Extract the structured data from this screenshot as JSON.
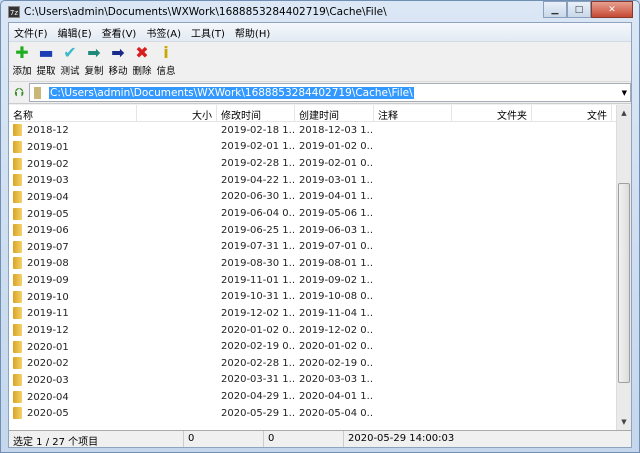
{
  "window": {
    "title": "C:\\Users\\admin\\Documents\\WXWork\\1688853284402719\\Cache\\File\\",
    "app_icon": "7z"
  },
  "menu": [
    "文件(F)",
    "编辑(E)",
    "查看(V)",
    "书签(A)",
    "工具(T)",
    "帮助(H)"
  ],
  "toolbar": [
    {
      "label": "添加",
      "icon": "plus-icon",
      "glyph": "✚",
      "color": "#1fae1f"
    },
    {
      "label": "提取",
      "icon": "minus-icon",
      "glyph": "▬",
      "color": "#1d3fb5"
    },
    {
      "label": "测试",
      "icon": "check-icon",
      "glyph": "✔",
      "color": "#3bb8c9"
    },
    {
      "label": "复制",
      "icon": "copy-arrow-icon",
      "glyph": "➡",
      "color": "#1f8a7a"
    },
    {
      "label": "移动",
      "icon": "move-arrow-icon",
      "glyph": "➡",
      "color": "#1a2a8a"
    },
    {
      "label": "删除",
      "icon": "delete-x-icon",
      "glyph": "✖",
      "color": "#d81e1e"
    },
    {
      "label": "信息",
      "icon": "info-icon",
      "glyph": "i",
      "color": "#c9a800"
    }
  ],
  "address": {
    "path": "C:\\Users\\admin\\Documents\\WXWork\\1688853284402719\\Cache\\File\\"
  },
  "columns": [
    "名称",
    "大小",
    "修改时间",
    "创建时间",
    "注释",
    "文件夹",
    "文件"
  ],
  "rows": [
    [
      "2018-12",
      "2019-02-18 1...",
      "2018-12-03 1..."
    ],
    [
      "2019-01",
      "2019-02-01 1...",
      "2019-01-02 0..."
    ],
    [
      "2019-02",
      "2019-02-28 1...",
      "2019-02-01 0..."
    ],
    [
      "2019-03",
      "2019-04-22 1...",
      "2019-03-01 1..."
    ],
    [
      "2019-04",
      "2020-06-30 1...",
      "2019-04-01 1..."
    ],
    [
      "2019-05",
      "2019-06-04 0...",
      "2019-05-06 1..."
    ],
    [
      "2019-06",
      "2019-06-25 1...",
      "2019-06-03 1..."
    ],
    [
      "2019-07",
      "2019-07-31 1...",
      "2019-07-01 0..."
    ],
    [
      "2019-08",
      "2019-08-30 1...",
      "2019-08-01 1..."
    ],
    [
      "2019-09",
      "2019-11-01 1...",
      "2019-09-02 1..."
    ],
    [
      "2019-10",
      "2019-10-31 1...",
      "2019-10-08 0..."
    ],
    [
      "2019-11",
      "2019-12-02 1...",
      "2019-11-04 1..."
    ],
    [
      "2019-12",
      "2020-01-02 0...",
      "2019-12-02 0..."
    ],
    [
      "2020-01",
      "2020-02-19 0...",
      "2020-01-02 0..."
    ],
    [
      "2020-02",
      "2020-02-28 1...",
      "2020-02-19 0..."
    ],
    [
      "2020-03",
      "2020-03-31 1...",
      "2020-03-03 1..."
    ],
    [
      "2020-04",
      "2020-04-29 1...",
      "2020-04-01 1..."
    ],
    [
      "2020-05",
      "2020-05-29 1...",
      "2020-05-04 0..."
    ]
  ],
  "status": {
    "selection": "选定 1 / 27 个项目",
    "size": "0",
    "packed": "0",
    "modified": "2020-05-29 14:00:03"
  }
}
